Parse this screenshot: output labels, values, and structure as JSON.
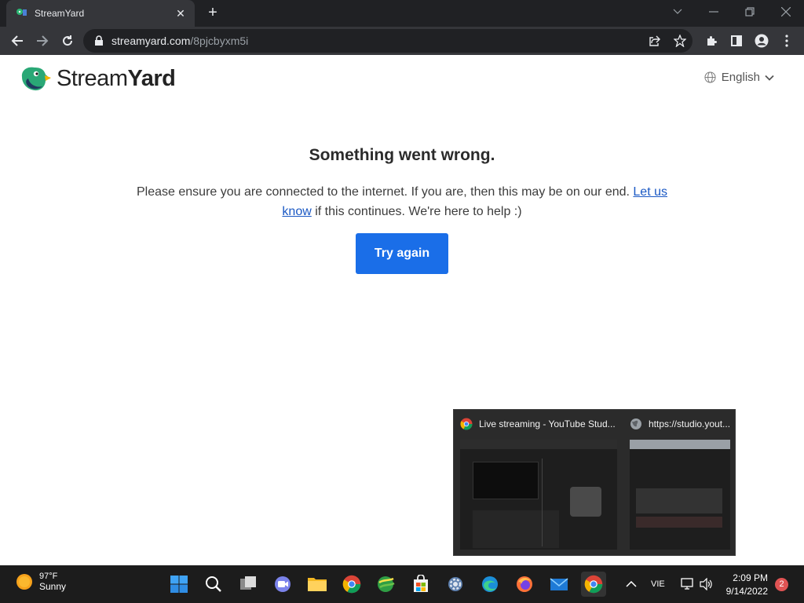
{
  "browser": {
    "tab_title": "StreamYard",
    "url_host": "streamyard.com",
    "url_path": "/8pjcbyxm5i"
  },
  "page": {
    "logo_stream": "Stream",
    "logo_yard": "Yard",
    "language": "English",
    "error_title": "Something went wrong.",
    "error_msg_before": "Please ensure you are connected to the internet. If you are, then this may be on our end. ",
    "error_link": "Let us know",
    "error_msg_after": " if this continues. We're here to help :)",
    "try_again_label": "Try again",
    "accent_color": "#1a6ee8"
  },
  "preview": {
    "items": [
      {
        "title": "Live streaming - YouTube Stud..."
      },
      {
        "title": "https://studio.yout..."
      }
    ]
  },
  "taskbar": {
    "weather_temp": "97°F",
    "weather_cond": "Sunny",
    "ime": "VIE",
    "time": "2:09 PM",
    "date": "9/14/2022",
    "notifications": "2"
  }
}
